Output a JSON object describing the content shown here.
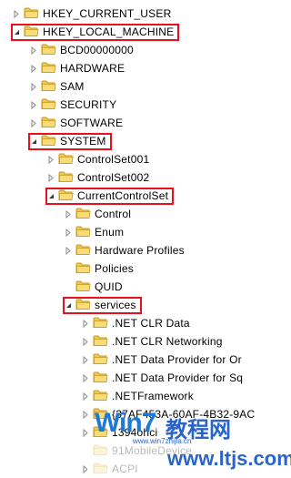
{
  "tree": {
    "nodes": [
      {
        "label": "HKEY_CURRENT_USER",
        "level": 0,
        "arrow": "collapsed",
        "highlight": false
      },
      {
        "label": "HKEY_LOCAL_MACHINE",
        "level": 0,
        "arrow": "expanded",
        "highlight": true
      },
      {
        "label": "BCD00000000",
        "level": 1,
        "arrow": "collapsed",
        "highlight": false
      },
      {
        "label": "HARDWARE",
        "level": 1,
        "arrow": "collapsed",
        "highlight": false
      },
      {
        "label": "SAM",
        "level": 1,
        "arrow": "collapsed",
        "highlight": false
      },
      {
        "label": "SECURITY",
        "level": 1,
        "arrow": "collapsed",
        "highlight": false
      },
      {
        "label": "SOFTWARE",
        "level": 1,
        "arrow": "collapsed",
        "highlight": false
      },
      {
        "label": "SYSTEM",
        "level": 1,
        "arrow": "expanded",
        "highlight": true
      },
      {
        "label": "ControlSet001",
        "level": 2,
        "arrow": "collapsed",
        "highlight": false
      },
      {
        "label": "ControlSet002",
        "level": 2,
        "arrow": "collapsed",
        "highlight": false
      },
      {
        "label": "CurrentControlSet",
        "level": 2,
        "arrow": "expanded",
        "highlight": true
      },
      {
        "label": "Control",
        "level": 3,
        "arrow": "collapsed",
        "highlight": false
      },
      {
        "label": "Enum",
        "level": 3,
        "arrow": "collapsed",
        "highlight": false
      },
      {
        "label": "Hardware Profiles",
        "level": 3,
        "arrow": "collapsed",
        "highlight": false
      },
      {
        "label": "Policies",
        "level": 3,
        "arrow": "none",
        "highlight": false
      },
      {
        "label": "QUID",
        "level": 3,
        "arrow": "none",
        "highlight": false
      },
      {
        "label": "services",
        "level": 3,
        "arrow": "expanded",
        "highlight": true
      },
      {
        "label": ".NET CLR Data",
        "level": 4,
        "arrow": "collapsed",
        "highlight": false
      },
      {
        "label": ".NET CLR Networking",
        "level": 4,
        "arrow": "collapsed",
        "highlight": false
      },
      {
        "label": ".NET Data Provider for Or",
        "level": 4,
        "arrow": "collapsed",
        "highlight": false
      },
      {
        "label": ".NET Data Provider for Sq",
        "level": 4,
        "arrow": "collapsed",
        "highlight": false
      },
      {
        "label": ".NETFramework",
        "level": 4,
        "arrow": "collapsed",
        "highlight": false
      },
      {
        "label": "{37AF453A-60AF-4B32-9AC",
        "level": 4,
        "arrow": "collapsed",
        "highlight": false
      },
      {
        "label": "1394ohci",
        "level": 4,
        "arrow": "collapsed",
        "highlight": false
      },
      {
        "label": "91MobileDevice",
        "level": 4,
        "arrow": "none",
        "highlight": false
      },
      {
        "label": "ACPI",
        "level": 4,
        "arrow": "collapsed",
        "highlight": false
      }
    ]
  },
  "watermark": {
    "logo": "Win7",
    "text": "教程网",
    "site": "www.ltjs.com",
    "small": "www.win7zhijia.cn"
  },
  "colors": {
    "highlight_box": "#e8101a",
    "folder_body": "#f2c94c",
    "folder_edge": "#c99a1f"
  }
}
